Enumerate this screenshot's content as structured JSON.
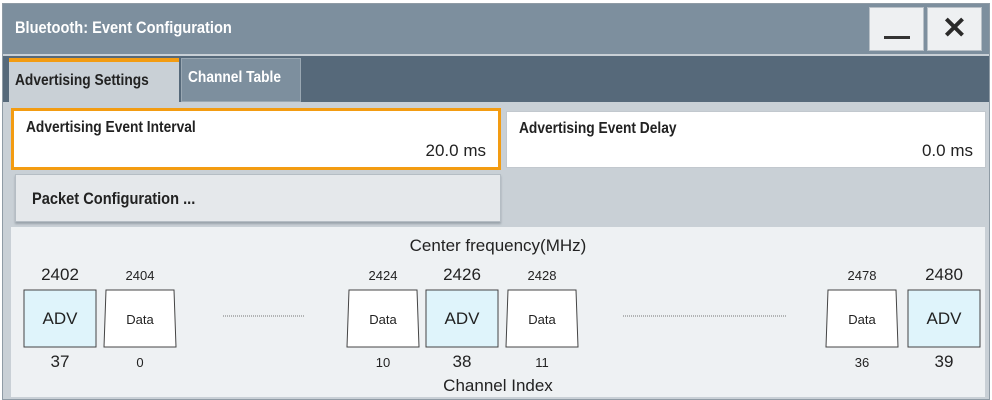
{
  "window": {
    "title": "Bluetooth: Event Configuration",
    "minimize_icon": "minimize-icon",
    "close_glyph": "✕"
  },
  "tabs": [
    {
      "label": "Advertising Settings",
      "active": true
    },
    {
      "label": "Channel Table",
      "active": false
    }
  ],
  "fields": {
    "interval": {
      "label": "Advertising Event Interval",
      "value": "20.0  ms"
    },
    "delay": {
      "label": "Advertising Event Delay",
      "value": "0.0  ms"
    }
  },
  "packet_button": {
    "label": "Packet Configuration ..."
  },
  "diagram": {
    "header": "Center frequency(MHz)",
    "footer": "Channel Index",
    "channels": [
      {
        "freq": "2402",
        "type": "ADV",
        "index": "37",
        "major": true
      },
      {
        "freq": "2404",
        "type": "Data",
        "index": "0",
        "major": false
      },
      {
        "freq": "2424",
        "type": "Data",
        "index": "10",
        "major": false
      },
      {
        "freq": "2426",
        "type": "ADV",
        "index": "38",
        "major": true
      },
      {
        "freq": "2428",
        "type": "Data",
        "index": "11",
        "major": false
      },
      {
        "freq": "2478",
        "type": "Data",
        "index": "36",
        "major": false
      },
      {
        "freq": "2480",
        "type": "ADV",
        "index": "39",
        "major": true
      }
    ],
    "colors": {
      "adv_fill": "#dff4fb",
      "data_fill": "#ffffff",
      "accent": "#f39c12"
    }
  }
}
